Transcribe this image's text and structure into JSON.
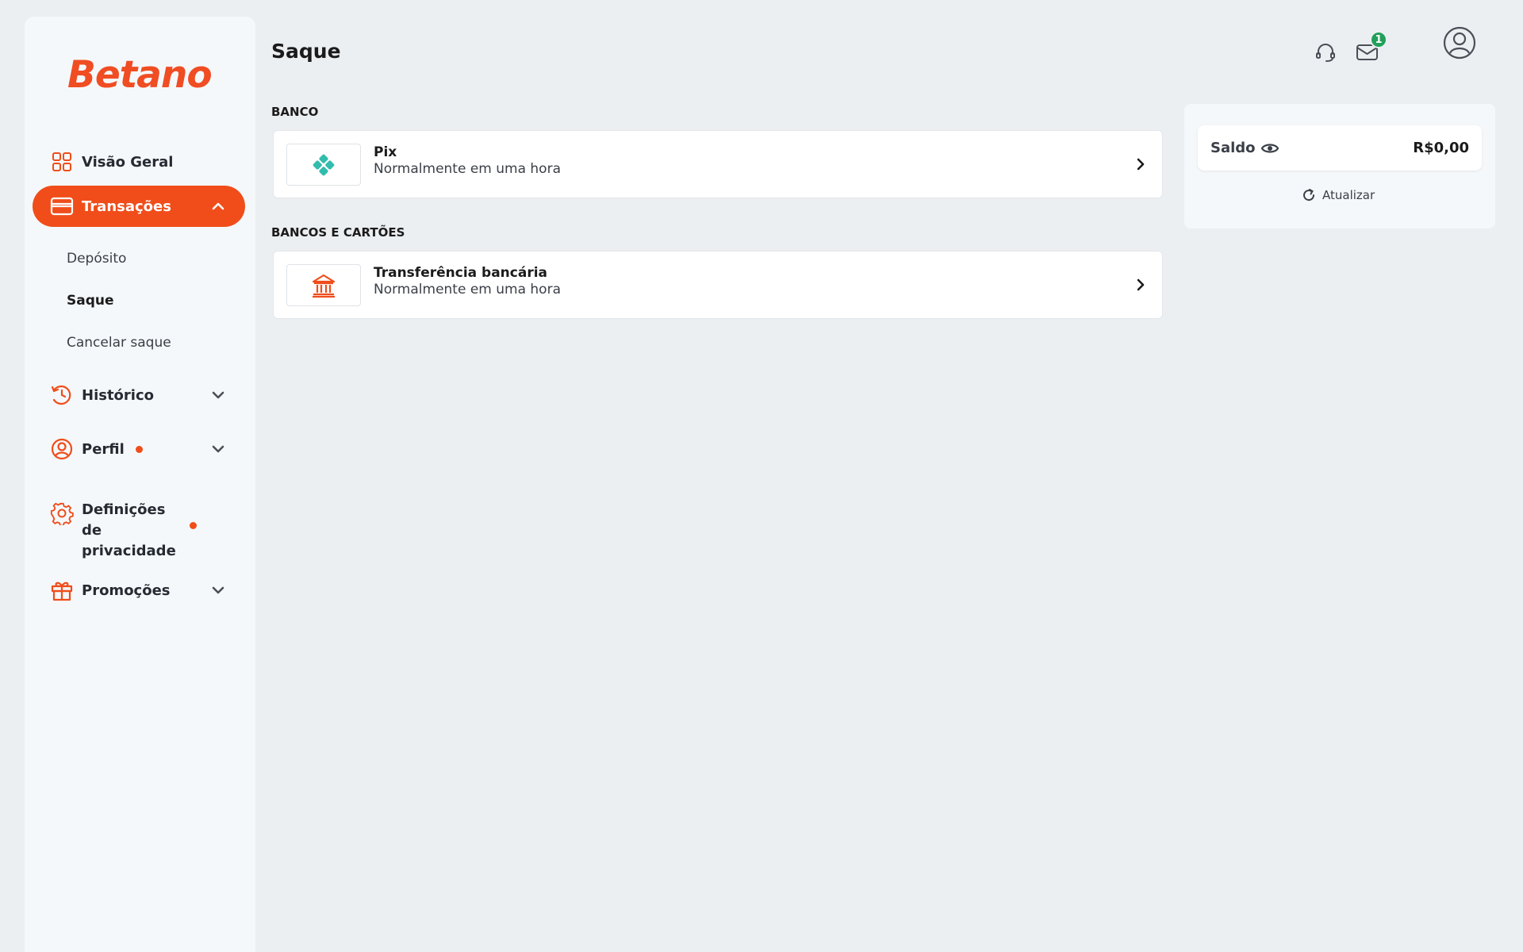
{
  "brand": {
    "logo_text": "Betano",
    "accent": "#f04d1a"
  },
  "header": {
    "title": "Saque",
    "icons": [
      "headset-icon",
      "mail-icon",
      "user-icon"
    ],
    "mail_badge": "1"
  },
  "sidebar": {
    "items": [
      {
        "label": "Visão Geral",
        "icon": "dashboard-icon"
      },
      {
        "label": "Transações",
        "icon": "card-icon",
        "expanded": true
      },
      {
        "label": "Histórico",
        "icon": "history-icon"
      },
      {
        "label": "Perfil",
        "icon": "profile-icon",
        "dot": true
      },
      {
        "label": "Definições de privacidade",
        "icon": "settings-icon",
        "dot": true
      },
      {
        "label": "Promoções",
        "icon": "gift-icon"
      }
    ],
    "sub_items": [
      {
        "label": "Depósito"
      },
      {
        "label": "Saque",
        "current": true
      },
      {
        "label": "Cancelar saque"
      }
    ]
  },
  "sections": [
    {
      "title": "BANCO",
      "methods": [
        {
          "name": "Pix",
          "desc": "Normalmente em uma hora",
          "icon": "pix-icon"
        }
      ]
    },
    {
      "title": "BANCOS E CARTÕES",
      "methods": [
        {
          "name": "Transferência bancária",
          "desc": "Normalmente em uma hora",
          "icon": "bank-icon"
        }
      ]
    }
  ],
  "balance": {
    "label": "Saldo",
    "value": "R$0,00",
    "refresh_label": "Atualizar"
  }
}
